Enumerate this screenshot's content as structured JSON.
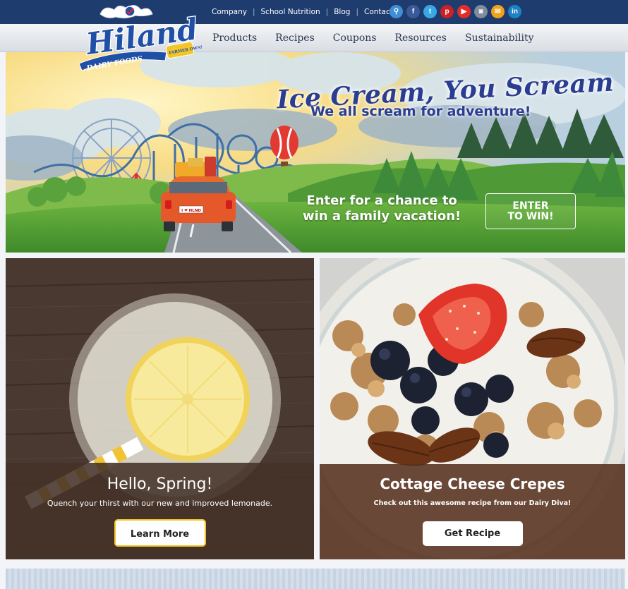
{
  "brand": {
    "name": "Hiland",
    "tagline": "DAIRY FOODS",
    "badge": "FARMER OWNED"
  },
  "utility_nav": [
    "Company",
    "School Nutrition",
    "Blog",
    "Contact"
  ],
  "social_icons": [
    {
      "name": "search-icon",
      "glyph": "⚲",
      "color": "#3e8fd6"
    },
    {
      "name": "facebook-icon",
      "glyph": "f",
      "color": "#3b5998"
    },
    {
      "name": "twitter-icon",
      "glyph": "t",
      "color": "#3aa8e6"
    },
    {
      "name": "pinterest-icon",
      "glyph": "p",
      "color": "#cb2027"
    },
    {
      "name": "youtube-icon",
      "glyph": "▶",
      "color": "#e52d27"
    },
    {
      "name": "instagram-icon",
      "glyph": "◙",
      "color": "#7e8c9c"
    },
    {
      "name": "email-icon",
      "glyph": "✉",
      "color": "#f3a21b"
    },
    {
      "name": "linkedin-icon",
      "glyph": "in",
      "color": "#1d82c4"
    }
  ],
  "main_nav": [
    "Products",
    "Recipes",
    "Coupons",
    "Resources",
    "Sustainability"
  ],
  "hero": {
    "title": "Ice Cream, You Scream",
    "subtitle": "We all scream for adventure!",
    "cta_text": "Enter for a chance to\nwin a family vacation!",
    "cta_button": "ENTER\nTO WIN!",
    "plate": "I ❤ HLND"
  },
  "promo_left": {
    "title": "Hello, Spring!",
    "description": "Quench your thirst with our new and improved lemonade.",
    "button": "Learn More"
  },
  "promo_right": {
    "title": "Cottage Cheese Crepes",
    "description": "Check out this awesome recipe from our Dairy Diva!",
    "button": "Get Recipe"
  },
  "colors": {
    "header_blue": "#1f3c6e",
    "title_blue": "#2a3d91",
    "accent_yellow": "#f2c629"
  }
}
